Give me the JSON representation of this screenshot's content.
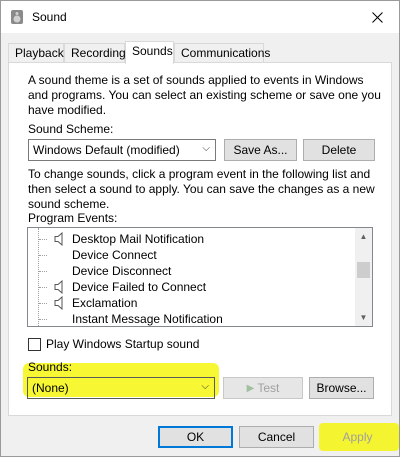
{
  "window": {
    "title": "Sound"
  },
  "tabs": [
    {
      "label": "Playback"
    },
    {
      "label": "Recording"
    },
    {
      "label": "Sounds"
    },
    {
      "label": "Communications"
    }
  ],
  "intro_text": [
    "A sound theme is a set of sounds applied to events in Windows",
    "and programs.  You can select an existing scheme or save one you",
    "have modified."
  ],
  "scheme": {
    "label": "Sound Scheme:",
    "value": "Windows Default (modified)",
    "save_as": "Save As...",
    "delete": "Delete"
  },
  "instructions": [
    "To change sounds, click a program event in the following list and",
    "then select a sound to apply.  You can save the changes as a new",
    "sound scheme."
  ],
  "events": {
    "label": "Program Events:",
    "items": [
      {
        "label": "Desktop Mail Notification",
        "icon": "speaker-icon"
      },
      {
        "label": "Device Connect",
        "icon": ""
      },
      {
        "label": "Device Disconnect",
        "icon": ""
      },
      {
        "label": "Device Failed to Connect",
        "icon": "speaker-icon"
      },
      {
        "label": "Exclamation",
        "icon": "speaker-icon"
      },
      {
        "label": "Instant Message Notification",
        "icon": ""
      }
    ]
  },
  "startup": {
    "label": "Play Windows Startup sound",
    "checked": false
  },
  "sounds": {
    "label": "Sounds:",
    "value": "(None)",
    "test": "Test",
    "browse": "Browse..."
  },
  "footer": {
    "ok": "OK",
    "cancel": "Cancel",
    "apply": "Apply"
  },
  "colors": {
    "highlight": "#f5f500",
    "accent": "#0078d7"
  }
}
